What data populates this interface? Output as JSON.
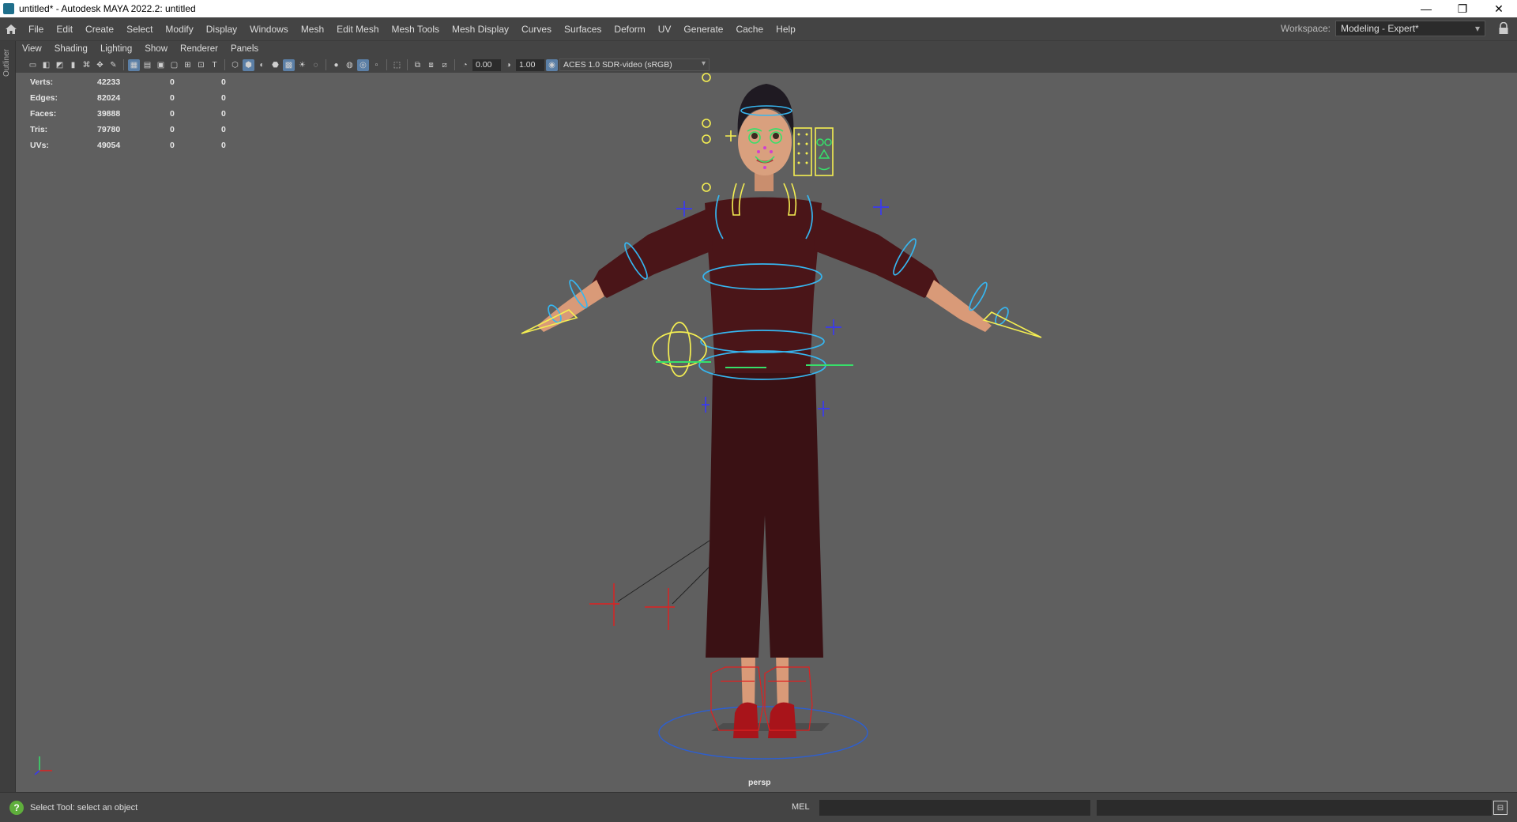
{
  "window": {
    "title": "untitled* - Autodesk MAYA 2022.2: untitled",
    "minimize": "—",
    "restore": "❐",
    "close": "✕"
  },
  "menubar": {
    "items": [
      "File",
      "Edit",
      "Create",
      "Select",
      "Modify",
      "Display",
      "Windows",
      "Mesh",
      "Edit Mesh",
      "Mesh Tools",
      "Mesh Display",
      "Curves",
      "Surfaces",
      "Deform",
      "UV",
      "Generate",
      "Cache",
      "Help"
    ],
    "workspace_label": "Workspace:",
    "workspace_value": "Modeling - Expert*"
  },
  "outliner_strip": {
    "label": "Outliner"
  },
  "panel_menu": {
    "items": [
      "View",
      "Shading",
      "Lighting",
      "Show",
      "Renderer",
      "Panels"
    ]
  },
  "toolbar": {
    "exposure": "0.00",
    "gamma": "1.00",
    "color_space": "ACES 1.0 SDR-video (sRGB)"
  },
  "hud": {
    "rows": [
      {
        "label": "Verts:",
        "value": "42233",
        "v2": "0",
        "v3": "0"
      },
      {
        "label": "Edges:",
        "value": "82024",
        "v2": "0",
        "v3": "0"
      },
      {
        "label": "Faces:",
        "value": "39888",
        "v2": "0",
        "v3": "0"
      },
      {
        "label": "Tris:",
        "value": "79780",
        "v2": "0",
        "v3": "0"
      },
      {
        "label": "UVs:",
        "value": "49054",
        "v2": "0",
        "v3": "0"
      }
    ]
  },
  "viewport": {
    "camera": "persp"
  },
  "statusbar": {
    "help_icon": "?",
    "message": "Select Tool: select an object",
    "mel_label": "MEL"
  },
  "colors": {
    "viewport_bg": "#5f5f5f",
    "control_blue": "#36b6f0",
    "control_yellow": "#f5ef52",
    "control_red": "#e02020",
    "outfit": "#3a1114"
  }
}
